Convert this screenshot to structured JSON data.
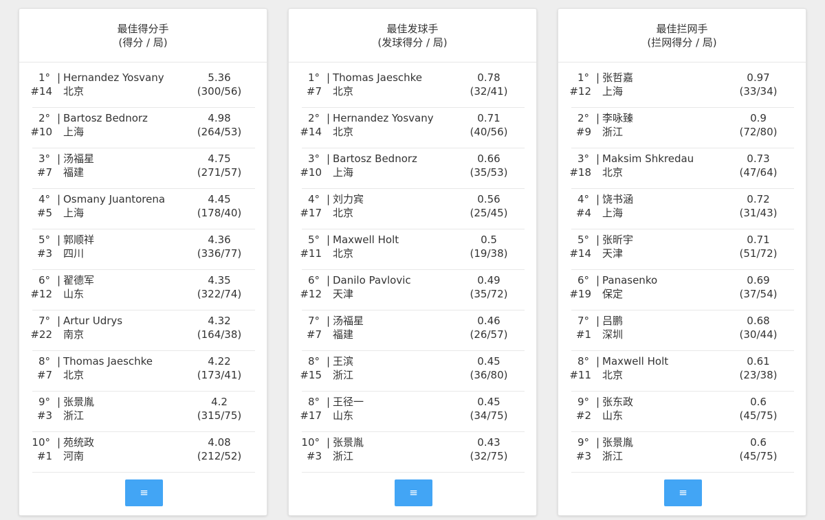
{
  "colors": {
    "accent": "#42a5f5",
    "card_bg": "#ffffff",
    "page_bg": "#eeeeee",
    "text": "#333333"
  },
  "cards": [
    {
      "title": "最佳得分手",
      "subtitle": "(得分 / 局)",
      "menu_icon": "≡",
      "rows": [
        {
          "rank": "1°",
          "num": "#14",
          "name": "Hernandez Yosvany",
          "team": "北京",
          "avg": "5.36",
          "ratio": "(300/56)"
        },
        {
          "rank": "2°",
          "num": "#10",
          "name": "Bartosz Bednorz",
          "team": "上海",
          "avg": "4.98",
          "ratio": "(264/53)"
        },
        {
          "rank": "3°",
          "num": "#7",
          "name": "汤福星",
          "team": "福建",
          "avg": "4.75",
          "ratio": "(271/57)"
        },
        {
          "rank": "4°",
          "num": "#5",
          "name": "Osmany Juantorena",
          "team": "上海",
          "avg": "4.45",
          "ratio": "(178/40)"
        },
        {
          "rank": "5°",
          "num": "#3",
          "name": "郭顺祥",
          "team": "四川",
          "avg": "4.36",
          "ratio": "(336/77)"
        },
        {
          "rank": "6°",
          "num": "#12",
          "name": "翟德军",
          "team": "山东",
          "avg": "4.35",
          "ratio": "(322/74)"
        },
        {
          "rank": "7°",
          "num": "#22",
          "name": "Artur Udrys",
          "team": "南京",
          "avg": "4.32",
          "ratio": "(164/38)"
        },
        {
          "rank": "8°",
          "num": "#7",
          "name": "Thomas Jaeschke",
          "team": "北京",
          "avg": "4.22",
          "ratio": "(173/41)"
        },
        {
          "rank": "9°",
          "num": "#3",
          "name": "张景胤",
          "team": "浙江",
          "avg": "4.2",
          "ratio": "(315/75)"
        },
        {
          "rank": "10°",
          "num": "#1",
          "name": "苑统政",
          "team": "河南",
          "avg": "4.08",
          "ratio": "(212/52)"
        }
      ]
    },
    {
      "title": "最佳发球手",
      "subtitle": "(发球得分 / 局)",
      "menu_icon": "≡",
      "rows": [
        {
          "rank": "1°",
          "num": "#7",
          "name": "Thomas Jaeschke",
          "team": "北京",
          "avg": "0.78",
          "ratio": "(32/41)"
        },
        {
          "rank": "2°",
          "num": "#14",
          "name": "Hernandez Yosvany",
          "team": "北京",
          "avg": "0.71",
          "ratio": "(40/56)"
        },
        {
          "rank": "3°",
          "num": "#10",
          "name": "Bartosz Bednorz",
          "team": "上海",
          "avg": "0.66",
          "ratio": "(35/53)"
        },
        {
          "rank": "4°",
          "num": "#17",
          "name": "刘力宾",
          "team": "北京",
          "avg": "0.56",
          "ratio": "(25/45)"
        },
        {
          "rank": "5°",
          "num": "#11",
          "name": "Maxwell Holt",
          "team": "北京",
          "avg": "0.5",
          "ratio": "(19/38)"
        },
        {
          "rank": "6°",
          "num": "#12",
          "name": "Danilo Pavlovic",
          "team": "天津",
          "avg": "0.49",
          "ratio": "(35/72)"
        },
        {
          "rank": "7°",
          "num": "#7",
          "name": "汤福星",
          "team": "福建",
          "avg": "0.46",
          "ratio": "(26/57)"
        },
        {
          "rank": "8°",
          "num": "#15",
          "name": "王滨",
          "team": "浙江",
          "avg": "0.45",
          "ratio": "(36/80)"
        },
        {
          "rank": "8°",
          "num": "#17",
          "name": "王径一",
          "team": "山东",
          "avg": "0.45",
          "ratio": "(34/75)"
        },
        {
          "rank": "10°",
          "num": "#3",
          "name": "张景胤",
          "team": "浙江",
          "avg": "0.43",
          "ratio": "(32/75)"
        }
      ]
    },
    {
      "title": "最佳拦网手",
      "subtitle": "(拦网得分 / 局)",
      "menu_icon": "≡",
      "rows": [
        {
          "rank": "1°",
          "num": "#12",
          "name": "张哲嘉",
          "team": "上海",
          "avg": "0.97",
          "ratio": "(33/34)"
        },
        {
          "rank": "2°",
          "num": "#9",
          "name": "李咏臻",
          "team": "浙江",
          "avg": "0.9",
          "ratio": "(72/80)"
        },
        {
          "rank": "3°",
          "num": "#18",
          "name": "Maksim Shkredau",
          "team": "北京",
          "avg": "0.73",
          "ratio": "(47/64)"
        },
        {
          "rank": "4°",
          "num": "#4",
          "name": "饶书涵",
          "team": "上海",
          "avg": "0.72",
          "ratio": "(31/43)"
        },
        {
          "rank": "5°",
          "num": "#14",
          "name": "张昕宇",
          "team": "天津",
          "avg": "0.71",
          "ratio": "(51/72)"
        },
        {
          "rank": "6°",
          "num": "#19",
          "name": "Panasenko",
          "team": "保定",
          "avg": "0.69",
          "ratio": "(37/54)"
        },
        {
          "rank": "7°",
          "num": "#1",
          "name": "吕鹏",
          "team": "深圳",
          "avg": "0.68",
          "ratio": "(30/44)"
        },
        {
          "rank": "8°",
          "num": "#11",
          "name": "Maxwell Holt",
          "team": "北京",
          "avg": "0.61",
          "ratio": "(23/38)"
        },
        {
          "rank": "9°",
          "num": "#2",
          "name": "张东政",
          "team": "山东",
          "avg": "0.6",
          "ratio": "(45/75)"
        },
        {
          "rank": "9°",
          "num": "#3",
          "name": "张景胤",
          "team": "浙江",
          "avg": "0.6",
          "ratio": "(45/75)"
        }
      ]
    }
  ]
}
